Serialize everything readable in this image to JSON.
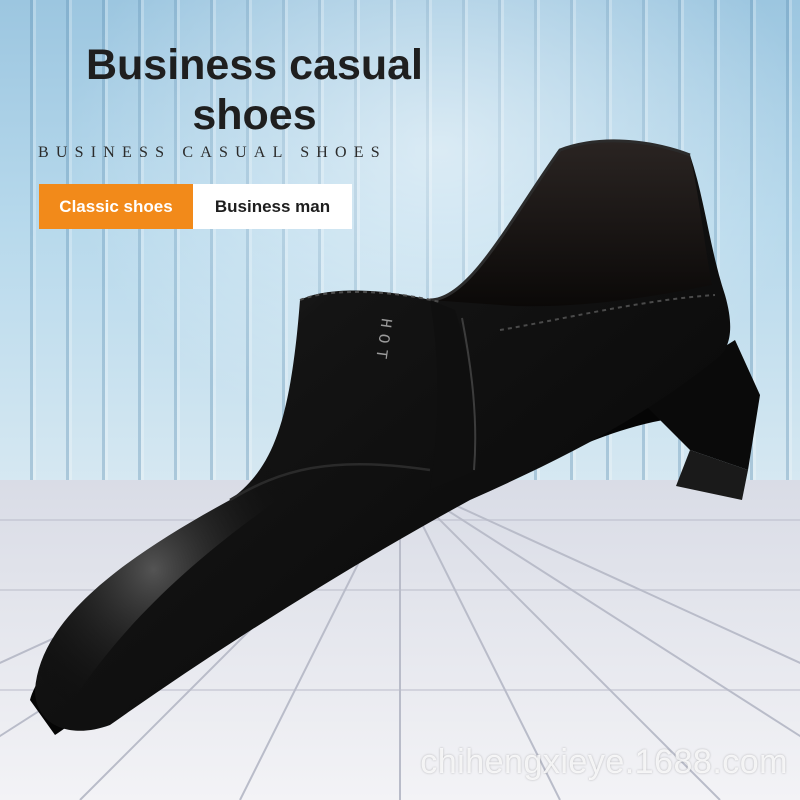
{
  "headline": {
    "title_line1": "Business casual",
    "title_line2": "shoes",
    "subtitle": "BUSINESS CASUAL SHOES"
  },
  "tags": [
    {
      "label": "Classic shoes",
      "color": "#f28a1a"
    },
    {
      "label": "Business man",
      "color": "#ffffff"
    }
  ],
  "product": {
    "badge_text": "HOT"
  },
  "watermark": "chihengxieye.1688.com",
  "colors": {
    "wall": "#b7d9ec",
    "floor": "#e6e8ee",
    "shoe": "#111111",
    "accent": "#f28a1a"
  }
}
